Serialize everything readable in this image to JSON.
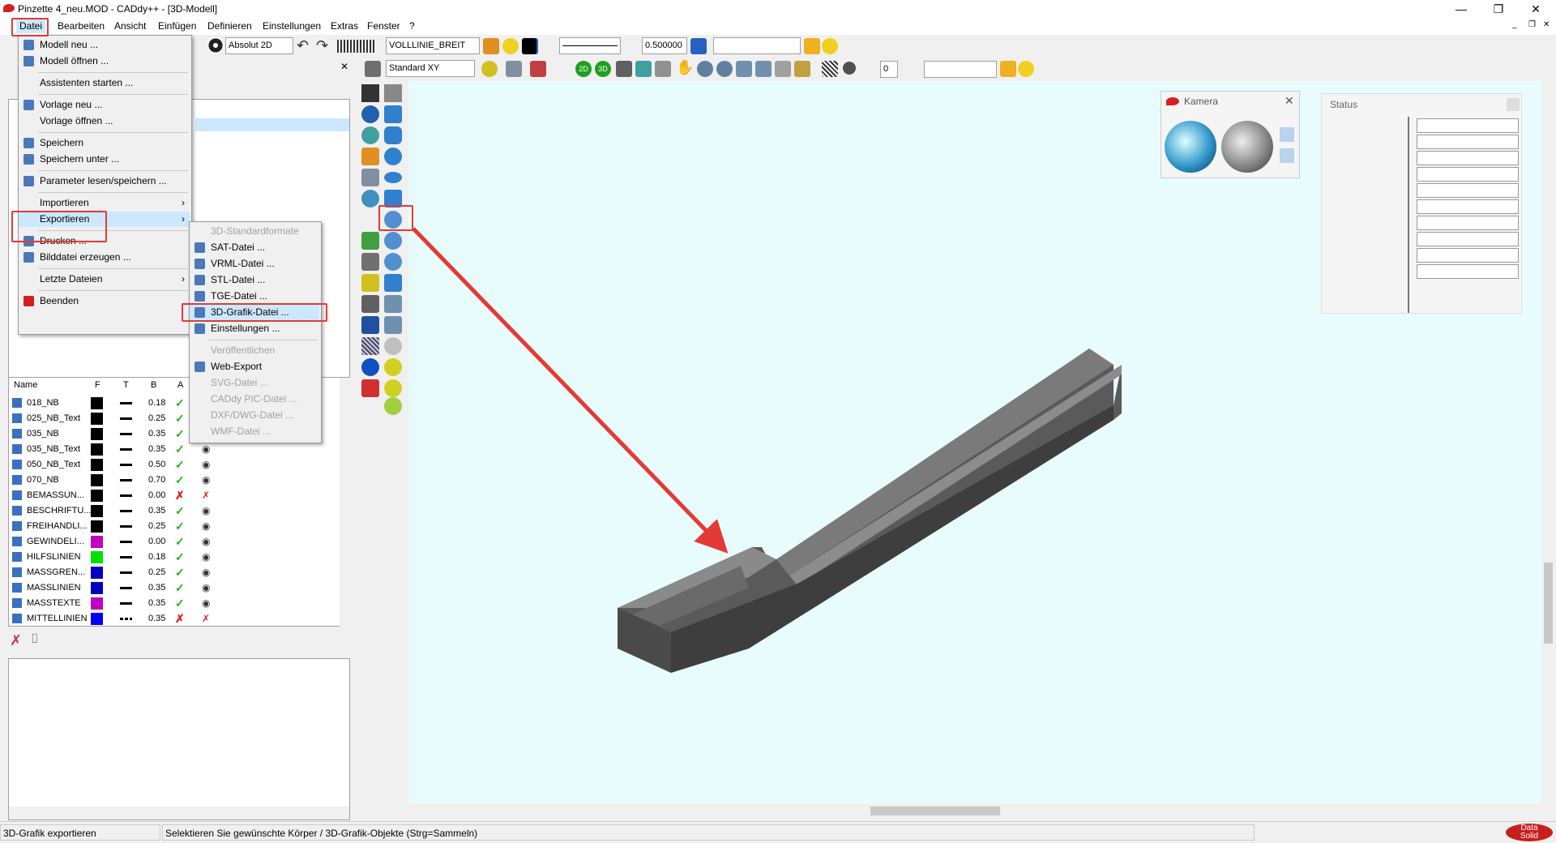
{
  "window": {
    "title": "Pinzette 4_neu.MOD  -  CADdy++ - [3D-Modell]",
    "minimize": "—",
    "restore": "❐",
    "close": "✕"
  },
  "menu": [
    "Datei",
    "Bearbeiten",
    "Ansicht",
    "Einfügen",
    "Definieren",
    "Einstellungen",
    "Extras",
    "Fenster",
    "?"
  ],
  "toolbar": {
    "mode": "Absolut 2D",
    "linetype": "VOLLLINIE_BREIT",
    "width": "0.500000",
    "view": "Standard XY",
    "number": "0"
  },
  "file_menu": [
    {
      "label": "Modell neu ...",
      "icon": "new-model-icon"
    },
    {
      "label": "Modell öffnen ...",
      "icon": "open-model-icon"
    },
    {
      "sep": true
    },
    {
      "label": "Assistenten starten ...",
      "icon": ""
    },
    {
      "sep": true
    },
    {
      "label": "Vorlage neu ...",
      "icon": "new-template-icon"
    },
    {
      "label": "Vorlage öffnen ...",
      "icon": ""
    },
    {
      "sep": true
    },
    {
      "label": "Speichern",
      "icon": "save-icon"
    },
    {
      "label": "Speichern unter ...",
      "icon": "save-as-icon"
    },
    {
      "sep": true
    },
    {
      "label": "Parameter lesen/speichern ...",
      "icon": "parameter-icon"
    },
    {
      "sep": true
    },
    {
      "label": "Importieren",
      "icon": "",
      "arrow": "›"
    },
    {
      "label": "Exportieren",
      "icon": "",
      "arrow": "›",
      "highlight": true
    },
    {
      "sep": true
    },
    {
      "label": "Drucken ...",
      "icon": "print-icon"
    },
    {
      "label": "Bilddatei erzeugen ...",
      "icon": "image-file-icon"
    },
    {
      "sep": true
    },
    {
      "label": "Letzte Dateien",
      "icon": "",
      "arrow": "›"
    },
    {
      "sep": true
    },
    {
      "label": "Beenden",
      "icon": "exit-icon"
    }
  ],
  "export_menu": [
    {
      "label": "3D-Standardformate",
      "disabled": true
    },
    {
      "label": "SAT-Datei ...",
      "icon": "sat-icon"
    },
    {
      "label": "VRML-Datei ...",
      "icon": "vrml-icon"
    },
    {
      "label": "STL-Datei ...",
      "icon": "stl-icon"
    },
    {
      "label": "TGE-Datei ...",
      "icon": "tge-icon"
    },
    {
      "label": "3D-Grafik-Datei ...",
      "icon": "3d-graphic-icon",
      "highlight": true
    },
    {
      "label": "Einstellungen ...",
      "icon": "settings-icon"
    },
    {
      "sep": true
    },
    {
      "label": "Veröffentlichen",
      "disabled": true
    },
    {
      "label": "Web-Export",
      "icon": "web-export-icon"
    },
    {
      "label": "SVG-Datei ...",
      "disabled": true
    },
    {
      "label": "CADdy PIC-Datei ...",
      "disabled": true
    },
    {
      "label": "DXF/DWG-Datei ...",
      "disabled": true
    },
    {
      "label": "WMF-Datei ...",
      "disabled": true
    }
  ],
  "layer_headers": {
    "name": "Name",
    "f": "F",
    "t": "T",
    "b": "B",
    "a": "A"
  },
  "layers": [
    {
      "name": "018_NB",
      "color": "#000000",
      "line": "solid",
      "b": "0.18",
      "active": true
    },
    {
      "name": "025_NB_Text",
      "color": "#000000",
      "line": "solid",
      "b": "0.25",
      "active": true
    },
    {
      "name": "035_NB",
      "color": "#000000",
      "line": "solid",
      "b": "0.35",
      "active": true
    },
    {
      "name": "035_NB_Text",
      "color": "#000000",
      "line": "solid",
      "b": "0.35",
      "active": true
    },
    {
      "name": "050_NB_Text",
      "color": "#000000",
      "line": "solid",
      "b": "0.50",
      "active": true
    },
    {
      "name": "070_NB",
      "color": "#000000",
      "line": "solid",
      "b": "0.70",
      "active": true
    },
    {
      "name": "BEMASSUN...",
      "color": "#000000",
      "line": "solid",
      "b": "0.00",
      "active": false
    },
    {
      "name": "BESCHRIFTU...",
      "color": "#000000",
      "line": "solid",
      "b": "0.35",
      "active": true
    },
    {
      "name": "FREIHANDLI...",
      "color": "#000000",
      "line": "solid",
      "b": "0.25",
      "active": true
    },
    {
      "name": "GEWINDELI...",
      "color": "#c000c0",
      "line": "solid",
      "b": "0.00",
      "active": true
    },
    {
      "name": "HILFSLINIEN",
      "color": "#00e000",
      "line": "solid",
      "b": "0.18",
      "active": true
    },
    {
      "name": "MASSGREN...",
      "color": "#0000c0",
      "line": "solid",
      "b": "0.25",
      "active": true
    },
    {
      "name": "MASSLINIEN",
      "color": "#0000c0",
      "line": "solid",
      "b": "0.35",
      "active": true
    },
    {
      "name": "MASSTEXTE",
      "color": "#c000c0",
      "line": "solid",
      "b": "0.35",
      "active": true
    },
    {
      "name": "MITTELLINIEN",
      "color": "#0000ff",
      "line": "dashdot",
      "b": "0.35",
      "active": false
    }
  ],
  "kamera": {
    "title": "Kamera"
  },
  "status_panel": {
    "title": "Status"
  },
  "statusbar": {
    "left": "3D-Grafik exportieren",
    "right": "Selektieren Sie gewünschte Körper / 3D-Grafik-Objekte (Strg=Sammeln)"
  },
  "brand": {
    "line1": "Data",
    "line2": "Solid"
  },
  "colors": {
    "highlight": "#e53935",
    "viewport": "#e8fbfd",
    "menu_hover": "#cce8ff"
  }
}
